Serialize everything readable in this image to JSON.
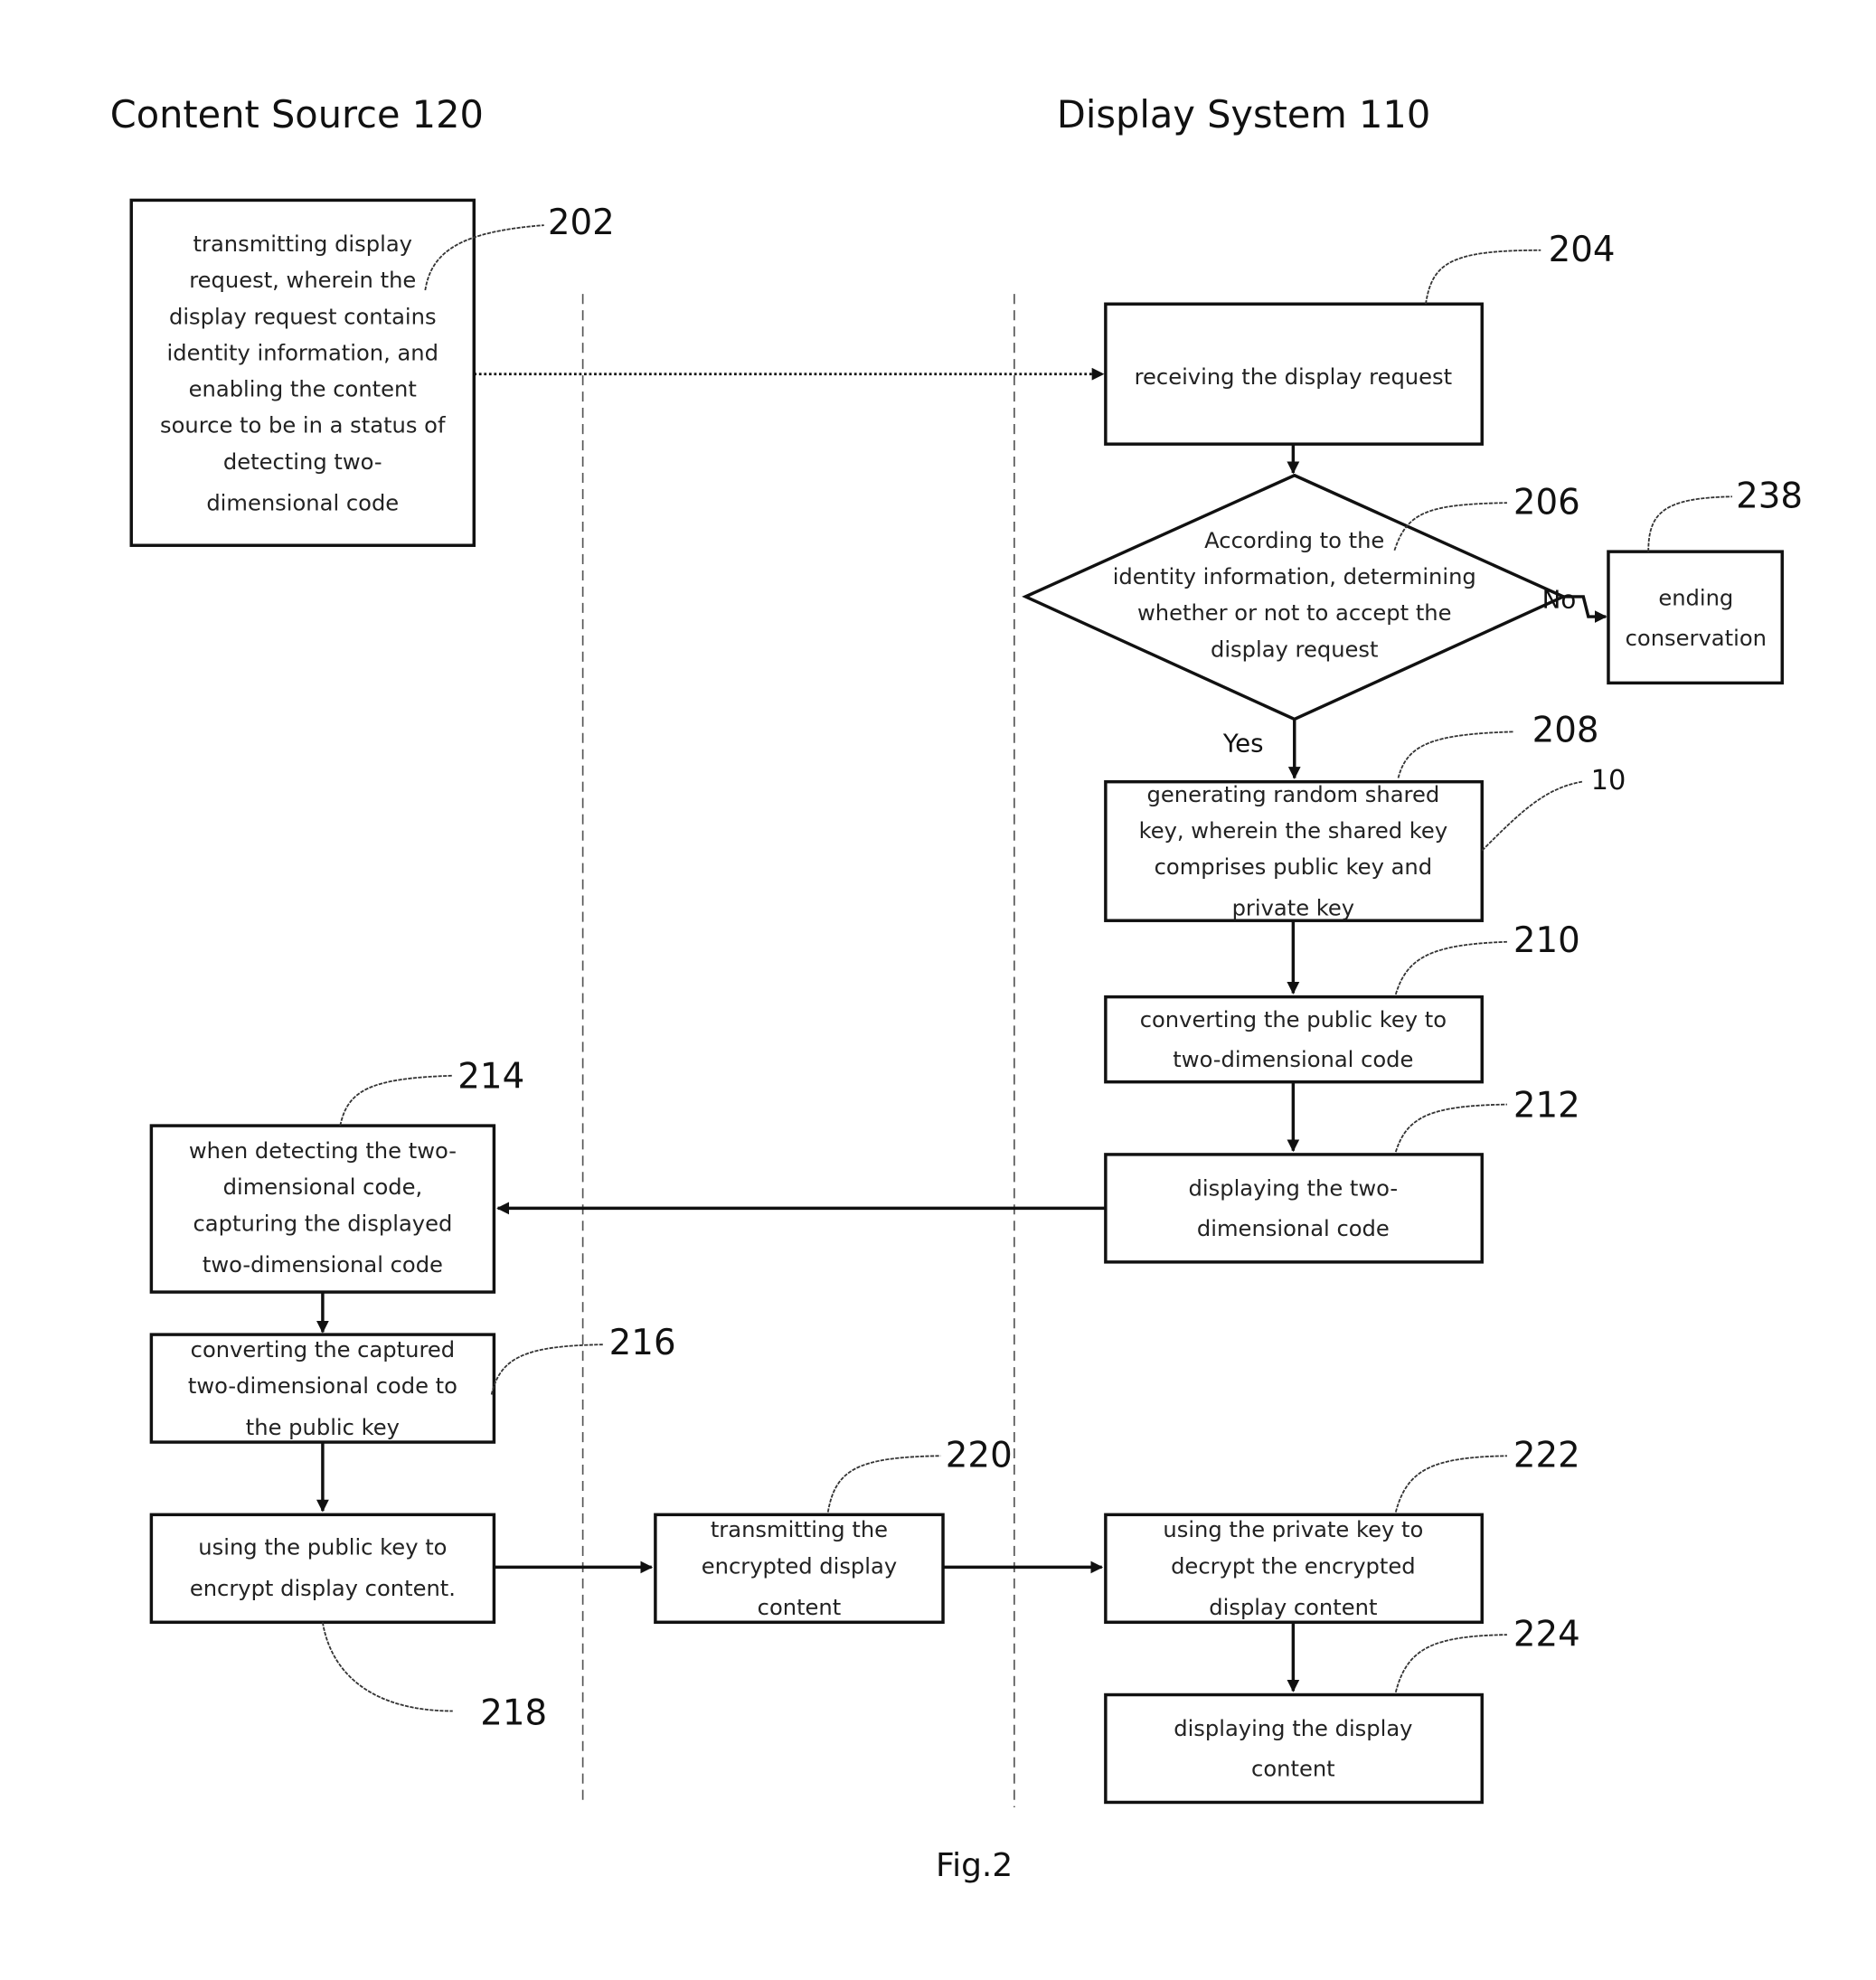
{
  "lanes": {
    "content_source": "Content Source 120",
    "display_system": "Display System 110"
  },
  "steps": {
    "s202": {
      "ref": "202",
      "lines": [
        "transmitting display",
        "request, wherein the",
        "display request contains",
        "identity information, and",
        "enabling the content",
        "source to be in a status of",
        "detecting two-",
        "dimensional code"
      ]
    },
    "s204": {
      "ref": "204",
      "lines": [
        "receiving the display request"
      ]
    },
    "s206": {
      "ref": "206",
      "lines": [
        "According to the",
        "identity information, determining",
        "whether or not to accept the",
        "display request"
      ]
    },
    "s238": {
      "ref": "238",
      "lines": [
        "ending",
        "conservation"
      ]
    },
    "s208": {
      "ref": "208",
      "ref2": "10",
      "lines": [
        "generating random shared",
        "key, wherein the shared key",
        "comprises public key and",
        "private key"
      ]
    },
    "s210": {
      "ref": "210",
      "lines": [
        "converting the public key to",
        "two-dimensional code"
      ]
    },
    "s212": {
      "ref": "212",
      "lines": [
        "displaying the two-",
        "dimensional code"
      ]
    },
    "s214": {
      "ref": "214",
      "lines": [
        "when detecting the two-",
        "dimensional code,",
        "capturing the displayed",
        "two-dimensional code"
      ]
    },
    "s216": {
      "ref": "216",
      "lines": [
        "converting the captured",
        "two-dimensional code to",
        "the public key"
      ]
    },
    "s218": {
      "ref": "218",
      "lines": [
        "using the public key to",
        "encrypt display content."
      ]
    },
    "s220": {
      "ref": "220",
      "lines": [
        "transmitting the",
        "encrypted display",
        "content"
      ]
    },
    "s222": {
      "ref": "222",
      "lines": [
        "using the private key to",
        "decrypt the encrypted",
        "display content"
      ]
    },
    "s224": {
      "ref": "224",
      "lines": [
        "displaying the display",
        "content"
      ]
    }
  },
  "branch_labels": {
    "no": "No",
    "yes": "Yes"
  },
  "caption": "Fig.2"
}
